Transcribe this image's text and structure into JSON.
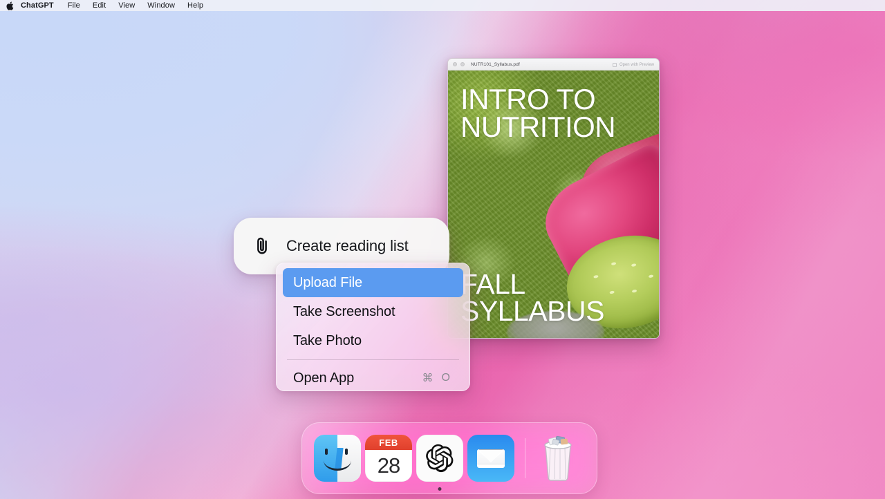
{
  "menubar": {
    "apple_icon": "apple-logo",
    "items": [
      {
        "label": "ChatGPT",
        "bold": true
      },
      {
        "label": "File"
      },
      {
        "label": "Edit"
      },
      {
        "label": "View"
      },
      {
        "label": "Window"
      },
      {
        "label": "Help"
      }
    ]
  },
  "pdf_window": {
    "title": "NUTR101_Syllabus.pdf",
    "open_with_label": "Open with Preview",
    "cover": {
      "title_line1": "INTRO TO",
      "title_line2": "NUTRITION",
      "subtitle_line1": "FALL",
      "subtitle_line2": "SYLLABUS"
    }
  },
  "pill": {
    "icon": "paperclip-icon",
    "label": "Create reading list"
  },
  "context_menu": {
    "items": [
      {
        "label": "Upload File",
        "selected": true,
        "shortcut": ""
      },
      {
        "label": "Take Screenshot",
        "selected": false,
        "shortcut": ""
      },
      {
        "label": "Take Photo",
        "selected": false,
        "shortcut": ""
      }
    ],
    "footer_items": [
      {
        "label": "Open App",
        "selected": false,
        "shortcut_mod": "⌘",
        "shortcut_key": "O"
      }
    ],
    "highlight_color": "#5b9bf0"
  },
  "dock": {
    "items": [
      {
        "name": "finder",
        "label": "Finder"
      },
      {
        "name": "calendar",
        "label": "Calendar",
        "month": "FEB",
        "day": "28"
      },
      {
        "name": "chatgpt",
        "label": "ChatGPT",
        "running": true
      },
      {
        "name": "mail",
        "label": "Mail"
      }
    ],
    "trash": {
      "name": "trash",
      "label": "Trash"
    }
  },
  "wallpaper": {
    "colors": {
      "blue": "#ccd8f5",
      "lavender": "#cfb9e8",
      "pink_light": "#f0a8d0",
      "pink_mid": "#ee85c4",
      "pink_deep": "#e4488f"
    }
  }
}
